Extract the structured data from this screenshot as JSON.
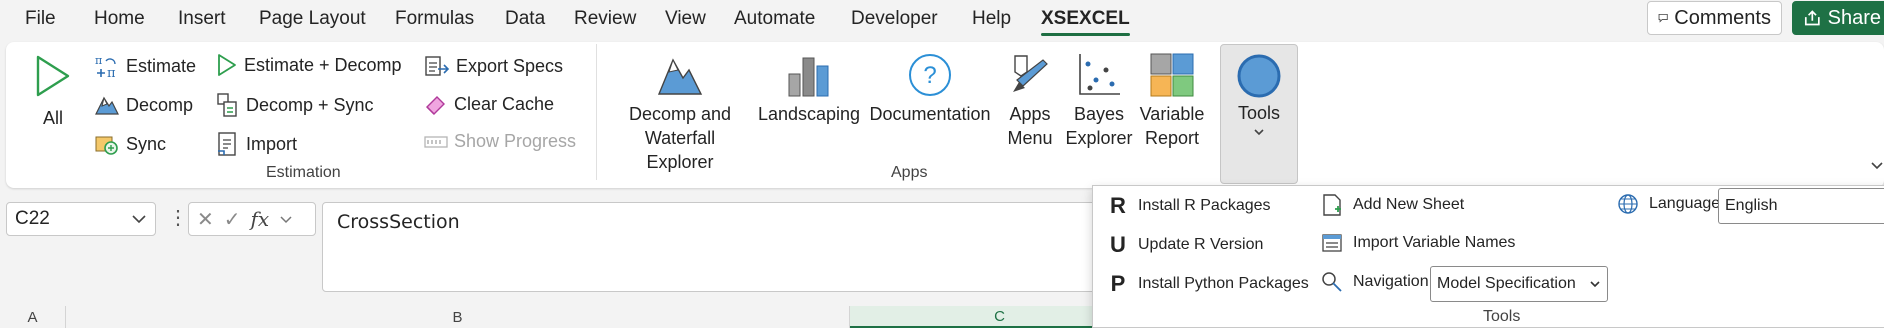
{
  "tabs": [
    {
      "label": "File",
      "active": false
    },
    {
      "label": "Home",
      "active": false
    },
    {
      "label": "Insert",
      "active": false
    },
    {
      "label": "Page Layout",
      "active": false
    },
    {
      "label": "Formulas",
      "active": false
    },
    {
      "label": "Data",
      "active": false
    },
    {
      "label": "Review",
      "active": false
    },
    {
      "label": "View",
      "active": false
    },
    {
      "label": "Automate",
      "active": false
    },
    {
      "label": "Developer",
      "active": false
    },
    {
      "label": "Help",
      "active": false
    },
    {
      "label": "XSEXCEL",
      "active": true
    }
  ],
  "topright": {
    "comments_label": "Comments",
    "share_label": "Share"
  },
  "ribbon": {
    "estimation": {
      "all_label": "All",
      "estimate_label": "Estimate",
      "decomp_label": "Decomp",
      "sync_label": "Sync",
      "estimate_decomp_label": "Estimate + Decomp",
      "decomp_sync_label": "Decomp + Sync",
      "import_label": "Import",
      "export_specs_label": "Export Specs",
      "clear_cache_label": "Clear Cache",
      "show_progress_label": "Show Progress",
      "group_label": "Estimation"
    },
    "apps": {
      "decomp_waterfall_label": "Decomp and\nWaterfall Explorer",
      "landscaping_label": "Landscaping",
      "documentation_label": "Documentation",
      "apps_menu_label": "Apps\nMenu",
      "bayes_explorer_label": "Bayes\nExplorer",
      "variable_report_label": "Variable\nReport",
      "tools_label": "Tools",
      "group_label": "Apps"
    }
  },
  "formula_bar": {
    "cell_ref": "C22",
    "fx_symbol": "fx",
    "value": "CrossSection"
  },
  "columns": [
    {
      "label": "A"
    },
    {
      "label": "B"
    },
    {
      "label": "C",
      "selected": true
    }
  ],
  "tools_panel": {
    "install_r": {
      "letter": "R",
      "label": "Install R Packages"
    },
    "update_r": {
      "letter": "U",
      "label": "Update R Version"
    },
    "install_python": {
      "letter": "P",
      "label": "Install Python Packages"
    },
    "add_sheet_label": "Add New Sheet",
    "import_names_label": "Import Variable Names",
    "navigation_label": "Navigation",
    "navigation_value": "Model Specification",
    "language_label": "Language",
    "language_value": "English",
    "group_label": "Tools"
  },
  "colors": {
    "accent": "#1e7145",
    "icon_blue": "#5b9bd5"
  }
}
